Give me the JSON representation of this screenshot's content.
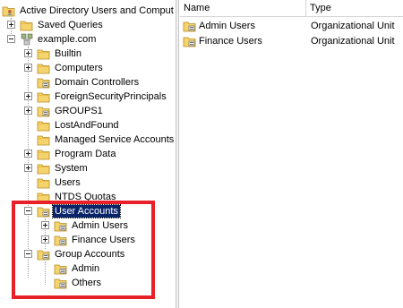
{
  "tree": {
    "root_label": "Active Directory Users and Comput",
    "saved_queries": "Saved Queries",
    "domain": "example.com",
    "items": [
      {
        "label": "Builtin"
      },
      {
        "label": "Computers"
      },
      {
        "label": "Domain Controllers"
      },
      {
        "label": "ForeignSecurityPrincipals"
      },
      {
        "label": "GROUPS1"
      },
      {
        "label": "LostAndFound"
      },
      {
        "label": "Managed Service Accounts"
      },
      {
        "label": "Program Data"
      },
      {
        "label": "System"
      },
      {
        "label": "Users"
      },
      {
        "label": "NTDS Quotas"
      },
      {
        "label": "User Accounts"
      },
      {
        "label": "Admin Users"
      },
      {
        "label": "Finance Users"
      },
      {
        "label": "Group Accounts"
      },
      {
        "label": "Admin"
      },
      {
        "label": "Others"
      }
    ]
  },
  "list": {
    "columns": [
      "Name",
      "Type"
    ],
    "rows": [
      {
        "name": "Admin Users",
        "type": "Organizational Unit"
      },
      {
        "name": "Finance Users",
        "type": "Organizational Unit"
      }
    ]
  },
  "colors": {
    "selection": "#0a246a",
    "highlight_box": "#e8202a",
    "folder": "#f5d46e"
  }
}
